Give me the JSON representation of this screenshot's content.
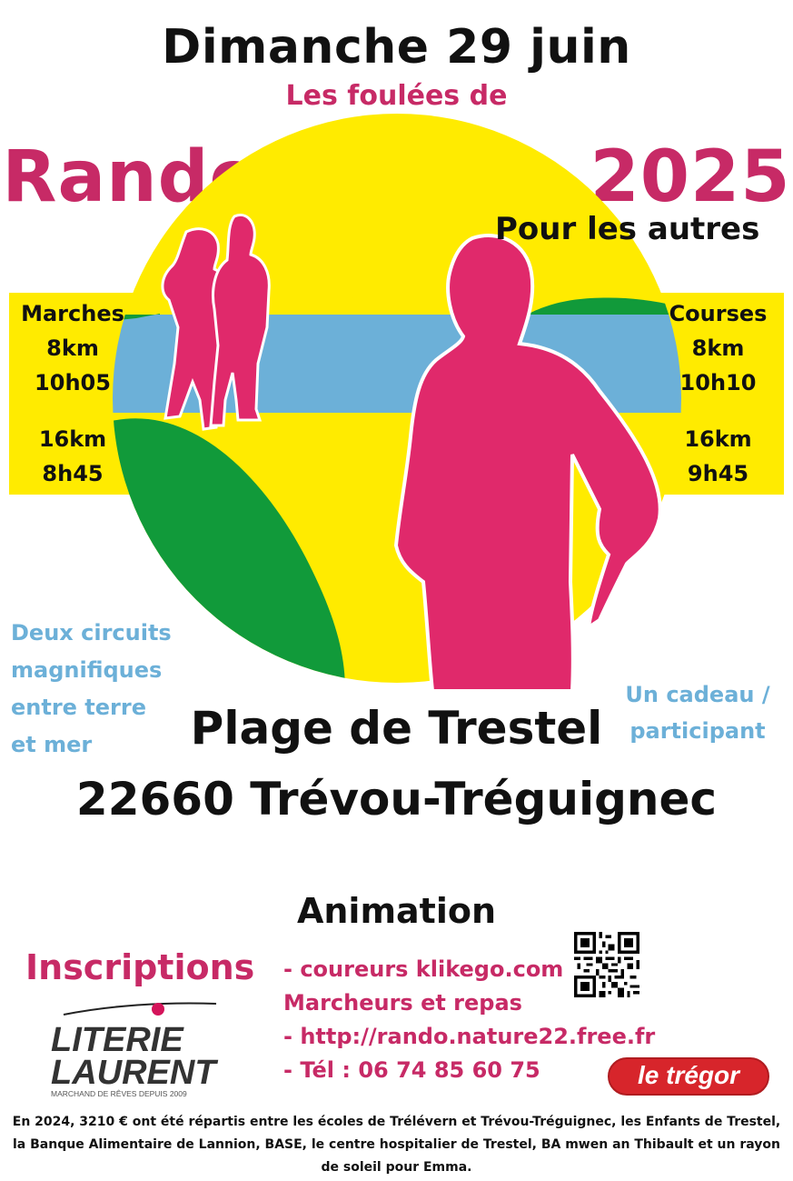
{
  "header": {
    "date": "Dimanche 29 juin",
    "subtitle": "Les foulées de",
    "title": "Rando Nature 2025",
    "tagline": "Pour les autres"
  },
  "walks": {
    "label": "Marches",
    "short_distance": "8km",
    "short_time": "10h05",
    "long_distance": "16km",
    "long_time": "8h45"
  },
  "runs": {
    "label": "Courses",
    "short_distance": "8km",
    "short_time": "10h10",
    "long_distance": "16km",
    "long_time": "9h45"
  },
  "circuits_text": [
    "Deux circuits",
    "magnifiques",
    "entre terre",
    "et mer"
  ],
  "gift_text": [
    "Un cadeau /",
    "participant"
  ],
  "location": {
    "place": "Plage de Trestel",
    "city": "22660 Trévou-Tréguignec"
  },
  "animation": "Animation",
  "inscriptions": "Inscriptions",
  "details": [
    "- coureurs klikego.com",
    "Marcheurs et repas",
    "- http://rando.nature22.free.fr",
    "- Tél : 06 74 85 60 75"
  ],
  "sponsor": {
    "line1": "LITERIE",
    "line2": "LAURENT",
    "tagline": "MARCHAND DE RÊVES DEPUIS 2009"
  },
  "newspaper": {
    "name": "le trégor"
  },
  "footer": "En 2024, 3210 € ont été répartis entre les écoles de Trélévern et Trévou-Tréguignec, les Enfants de Trestel,  la Banque Alimentaire de Lannion, BASE, le centre hospitalier de Trestel, BA mwen an Thibault et un rayon de soleil pour Emma.",
  "colors": {
    "pink": "#e0296b",
    "yellow": "#ffeb00",
    "green": "#119a3a",
    "sky_blue": "#6cb0d8",
    "text_blue": "#6cb0d8",
    "text_pink": "#c72a66"
  }
}
